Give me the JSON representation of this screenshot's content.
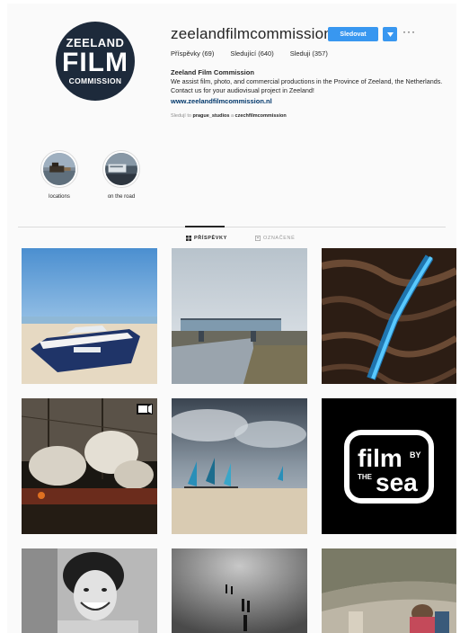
{
  "profile": {
    "avatar_text": [
      "ZEELAND",
      "FILM",
      "COMMISSION"
    ],
    "username": "zeelandfilmcommission",
    "follow_label": "Sledovat",
    "more_label": "···",
    "stats": {
      "posts": "Příspěvky (69)",
      "followers": "Sledující (640)",
      "following": "Sleduji (357)"
    },
    "bio_name": "Zeeland Film Commission",
    "bio_text": "We assist film, photo, and commercial productions in the Province of Zeeland, the Netherlands. Contact us for your audiovisual project in Zeeland!",
    "bio_link": "www.zeelandfilmcommission.nl",
    "followed_by_prefix": "Sledují to",
    "followed_by_names": "prague_studios",
    "followed_by_sep": "a",
    "followed_by_other": "czechfilmcommission"
  },
  "highlights": [
    {
      "label": "locations"
    },
    {
      "label": "on the road"
    }
  ],
  "tabs": [
    {
      "label": "PŘÍSPĚVKY",
      "active": true
    },
    {
      "label": "OZNAČENÉ",
      "active": false
    }
  ],
  "posts": {
    "film_by_the_sea": {
      "line1": "film",
      "by": "BY",
      "the": "THE",
      "line2": "sea"
    }
  },
  "colors": {
    "accent": "#3897f0",
    "link": "#00376b",
    "avatar_bg": "#1d2a3b"
  }
}
